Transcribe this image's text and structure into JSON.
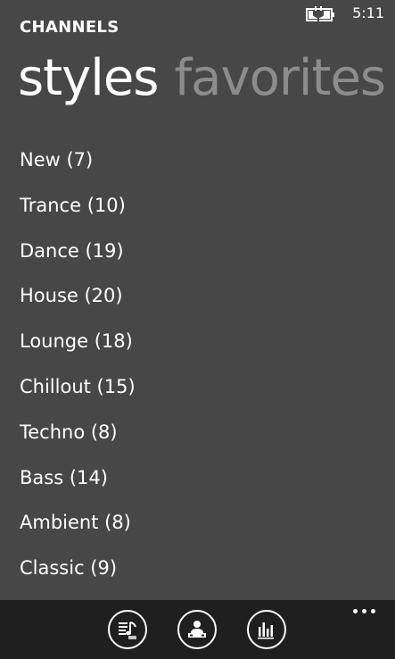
{
  "status_bar": {
    "time": "5:11",
    "battery_icon": "battery-charging-icon"
  },
  "header": {
    "title": "CHANNELS"
  },
  "pivot": {
    "tabs": [
      {
        "label": "styles",
        "active": true
      },
      {
        "label": "favorites",
        "active": false
      }
    ]
  },
  "channels": [
    {
      "label": "New (7)"
    },
    {
      "label": "Trance (10)"
    },
    {
      "label": "Dance (19)"
    },
    {
      "label": "House (20)"
    },
    {
      "label": "Lounge (18)"
    },
    {
      "label": "Chillout (15)"
    },
    {
      "label": "Techno (8)"
    },
    {
      "label": "Bass (14)"
    },
    {
      "label": "Ambient (8)"
    },
    {
      "label": "Classic (9)"
    }
  ],
  "app_bar": {
    "buttons": [
      {
        "icon": "playlist-icon"
      },
      {
        "icon": "dj-icon"
      },
      {
        "icon": "equalizer-icon"
      }
    ],
    "more_icon": "more-icon"
  },
  "colors": {
    "background": "#474747",
    "app_bar": "#1f1f1f",
    "text": "#ffffff",
    "inactive_tab": "#8c8c8c"
  }
}
